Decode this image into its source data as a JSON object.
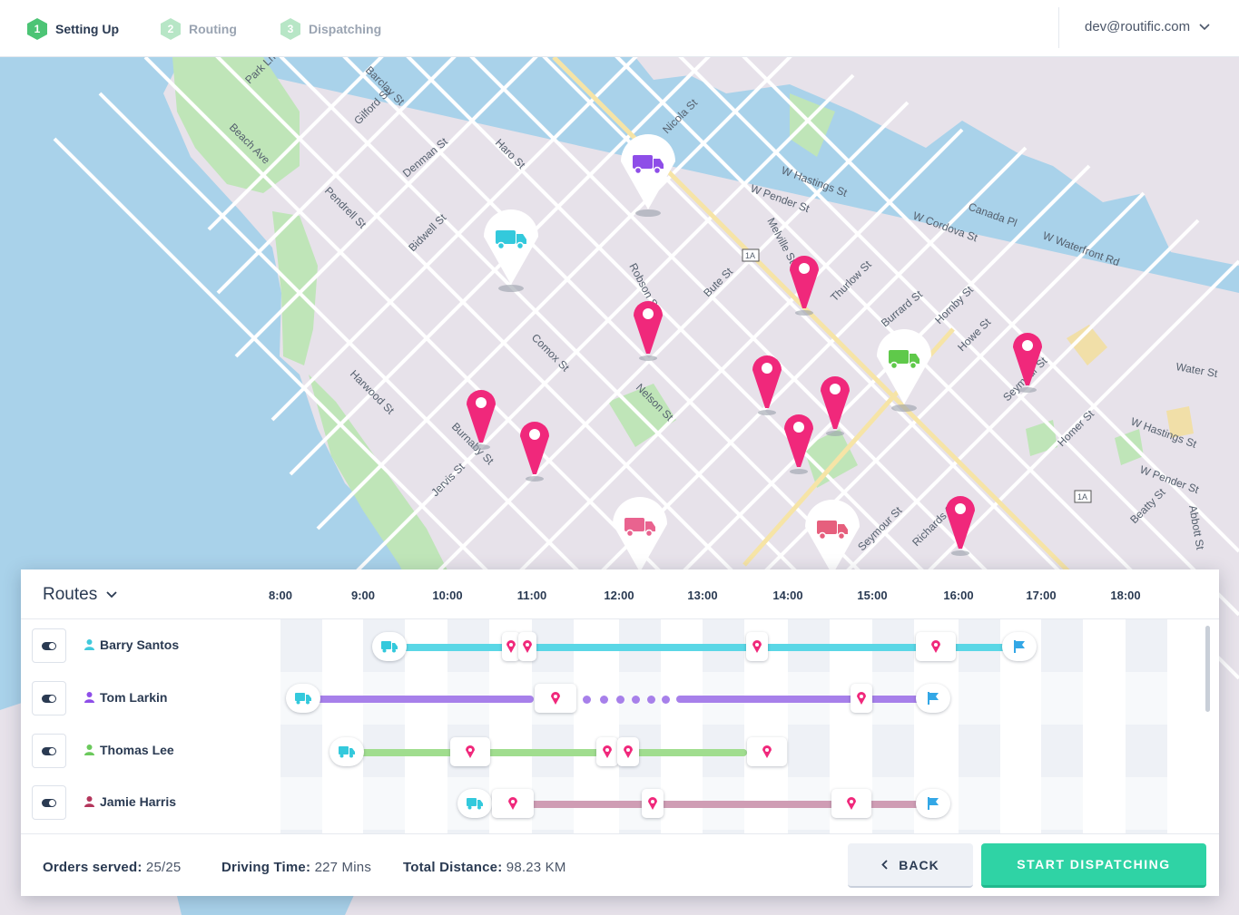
{
  "header": {
    "steps": [
      {
        "number": "1",
        "label": "Setting Up"
      },
      {
        "number": "2",
        "label": "Routing"
      },
      {
        "number": "3",
        "label": "Dispatching"
      }
    ],
    "user_email": "dev@routific.com"
  },
  "map": {
    "street_labels": [
      "Robson St",
      "W Pender St",
      "W Hastings St",
      "W Cordova St",
      "Canada Pl",
      "W Waterfront Rd",
      "Burrard St",
      "Thurlow St",
      "Melville St",
      "Hornby St",
      "Howe St",
      "Seymour St",
      "Water St",
      "W Hastings St",
      "W Pender St",
      "Homer St",
      "Richards St",
      "Beatty St",
      "Abbott St",
      "Denman St",
      "Haro St",
      "Barclay St",
      "Nicola St",
      "Bute St",
      "Jervis St",
      "Comox St",
      "Pendrell St",
      "Nelson St",
      "Gilford St",
      "Park Ln",
      "Beach Ave",
      "Bidwell St",
      "Harwood St",
      "Burnaby St",
      "Seymour St",
      "1A",
      "1A"
    ]
  },
  "routes_panel": {
    "title": "Routes",
    "hours": [
      "8:00",
      "9:00",
      "10:00",
      "11:00",
      "12:00",
      "13:00",
      "14:00",
      "15:00",
      "16:00",
      "17:00",
      "18:00"
    ],
    "drivers": [
      {
        "name": "Barry Santos",
        "color": "#41c9dc"
      },
      {
        "name": "Tom Larkin",
        "color": "#8e4ee8"
      },
      {
        "name": "Thomas Lee",
        "color": "#6bc95c"
      },
      {
        "name": "Jamie Harris",
        "color": "#b4365c"
      }
    ]
  },
  "footer": {
    "orders_label": "Orders served:",
    "orders_value": "25/25",
    "driving_label": "Driving Time:",
    "driving_value": "227 Mins",
    "distance_label": "Total Distance:",
    "distance_value": "98.23 KM",
    "back_label": "BACK",
    "dispatch_label": "START DISPATCHING"
  },
  "colors": {
    "accent_green": "#2fd3a5",
    "step_green": "#4cc475",
    "pin_pink": "#f0287b",
    "route_cyan": "#5ad7e6",
    "route_purple": "#a780ea",
    "route_green": "#a0dd8e",
    "route_mauve": "#cf9db4"
  }
}
